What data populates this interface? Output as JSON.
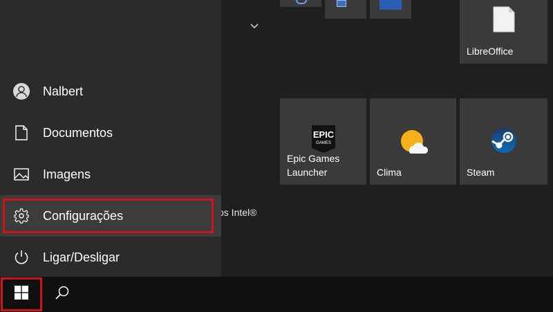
{
  "start_menu": {
    "items": [
      {
        "label": "Nalbert",
        "icon": "user-icon"
      },
      {
        "label": "Documentos",
        "icon": "document-icon"
      },
      {
        "label": "Imagens",
        "icon": "image-icon"
      },
      {
        "label": "Configurações",
        "icon": "gear-icon"
      },
      {
        "label": "Ligar/Desligar",
        "icon": "power-icon"
      }
    ],
    "partial_text": "os Intel®"
  },
  "tiles": {
    "libreoffice": {
      "label": "LibreOffice",
      "icon": "libreoffice-icon"
    },
    "epic": {
      "label_line1": "Epic Games",
      "label_line2": "Launcher",
      "icon": "epic-games-icon",
      "logo_top": "EPIC",
      "logo_bottom": "GAMES"
    },
    "clima": {
      "label": "Clima",
      "icon": "weather-icon"
    },
    "steam": {
      "label": "Steam",
      "icon": "steam-icon"
    }
  },
  "taskbar": {
    "start_icon": "windows-icon",
    "search_icon": "search-icon"
  },
  "colors": {
    "highlight": "#d0141b",
    "tile": "#3a3a3a",
    "rail": "#2b2b2b",
    "taskbar": "#101010"
  }
}
